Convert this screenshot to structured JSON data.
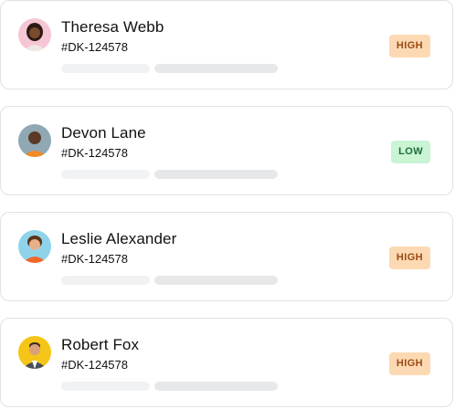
{
  "tickets": [
    {
      "name": "Theresa Webb",
      "id": "#DK-124578",
      "priority": "HIGH",
      "priority_level": "high",
      "avatar_bg": "#f6c6d4"
    },
    {
      "name": "Devon Lane",
      "id": "#DK-124578",
      "priority": "LOW",
      "priority_level": "low",
      "avatar_bg": "#8fa8b3"
    },
    {
      "name": "Leslie Alexander",
      "id": "#DK-124578",
      "priority": "HIGH",
      "priority_level": "high",
      "avatar_bg": "#8fd3ea"
    },
    {
      "name": "Robert Fox",
      "id": "#DK-124578",
      "priority": "HIGH",
      "priority_level": "high",
      "avatar_bg": "#f5c518"
    }
  ],
  "colors": {
    "high_bg": "#fcd9b3",
    "high_text": "#9a4a12",
    "low_bg": "#c9f5d5",
    "low_text": "#1f6b35",
    "card_border": "#dfe2e6"
  }
}
